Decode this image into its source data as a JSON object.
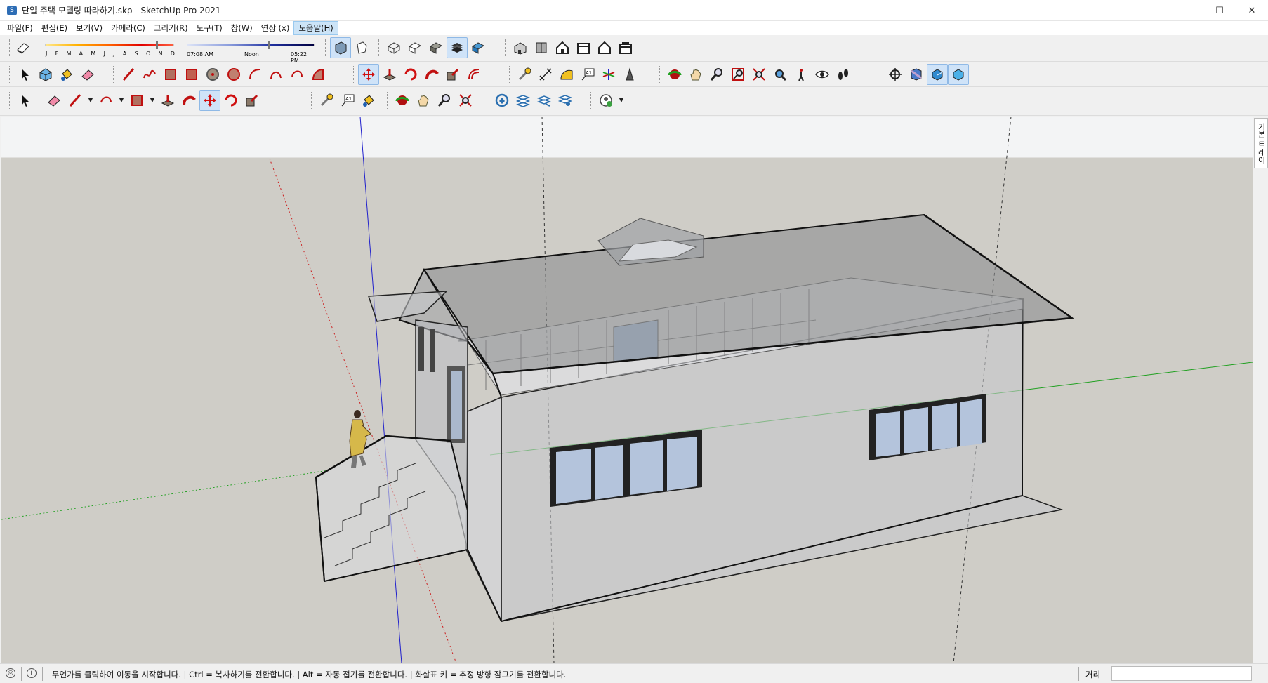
{
  "window": {
    "title": "단일 주택 모델링 따라하기.skp - SketchUp Pro 2021",
    "minimize": "—",
    "maximize": "☐",
    "close": "✕"
  },
  "menu": [
    {
      "label": "파일(F)"
    },
    {
      "label": "편집(E)"
    },
    {
      "label": "보기(V)"
    },
    {
      "label": "카메라(C)"
    },
    {
      "label": "그리기(R)"
    },
    {
      "label": "도구(T)"
    },
    {
      "label": "창(W)"
    },
    {
      "label": "연장 (x)"
    },
    {
      "label": "도움말(H)",
      "active": true
    }
  ],
  "shadows": {
    "months": [
      "J",
      "F",
      "M",
      "A",
      "M",
      "J",
      "J",
      "A",
      "S",
      "O",
      "N",
      "D"
    ],
    "time_start": "07:08 AM",
    "time_mid": "Noon",
    "time_end": "05:22 PM"
  },
  "toolbar_icons": {
    "row1": [
      "eraser-icon",
      "xray-style-icon",
      "back-edges-icon",
      "wireframe-icon",
      "hidden-line-icon",
      "shaded-icon",
      "shaded-textures-icon",
      "monochrome-icon",
      "iso-view-icon",
      "top-view-icon",
      "front-view-icon",
      "right-view-icon",
      "back-view-icon",
      "left-view-icon"
    ],
    "row2": [
      "select-icon",
      "component-icon",
      "paint-bucket-icon",
      "eraser-icon",
      "line-icon",
      "freehand-icon",
      "rectangle-icon",
      "rotated-rect-icon",
      "circle-icon",
      "polygon-icon",
      "arc-icon",
      "two-point-arc-icon",
      "three-point-arc-icon",
      "pie-icon",
      "push-pull-icon",
      "move-icon",
      "follow-me-icon",
      "rotate-icon",
      "scale-icon",
      "offset-icon",
      "tape-measure-icon",
      "dimension-icon",
      "protractor-icon",
      "text-icon",
      "axes-icon",
      "3d-text-icon",
      "orbit-icon",
      "pan-icon",
      "zoom-icon",
      "zoom-window-icon",
      "zoom-extents-icon",
      "position-camera-icon",
      "walk-icon",
      "look-around-icon",
      "footprints-icon",
      "section-plane-icon",
      "section-display-icon",
      "section-cut-icon",
      "section-fill-icon"
    ],
    "row3": [
      "select-icon",
      "eraser-icon",
      "pencil-icon",
      "arc-icon",
      "rectangle-icon",
      "push-pull-icon",
      "offset-icon",
      "move-icon",
      "rotate-icon",
      "scale-icon",
      "tape-measure-icon",
      "text-icon",
      "paint-bucket-icon",
      "orbit-icon",
      "pan-icon",
      "zoom-icon",
      "zoom-extents-icon",
      "warehouse-icon",
      "layers-icon",
      "layer-manage-icon",
      "extension-icon",
      "account-icon"
    ]
  },
  "tray": {
    "tab_label": "기본 트레이"
  },
  "status": {
    "message": "무언가를 클릭하여 이동을 시작합니다. | Ctrl = 복사하기를 전환합니다. | Alt = 자동 접기를 전환합니다. | 화살표 키 = 추정 방향 잠그기를 전환합니다.",
    "measure_label": "거리",
    "measure_value": ""
  },
  "colors": {
    "sky": "#f3f4f5",
    "ground": "#cfcdc7",
    "axis_red": "#cc2020",
    "axis_green": "#20a020",
    "axis_blue": "#2020cc",
    "selection": "#cfe3f8"
  }
}
